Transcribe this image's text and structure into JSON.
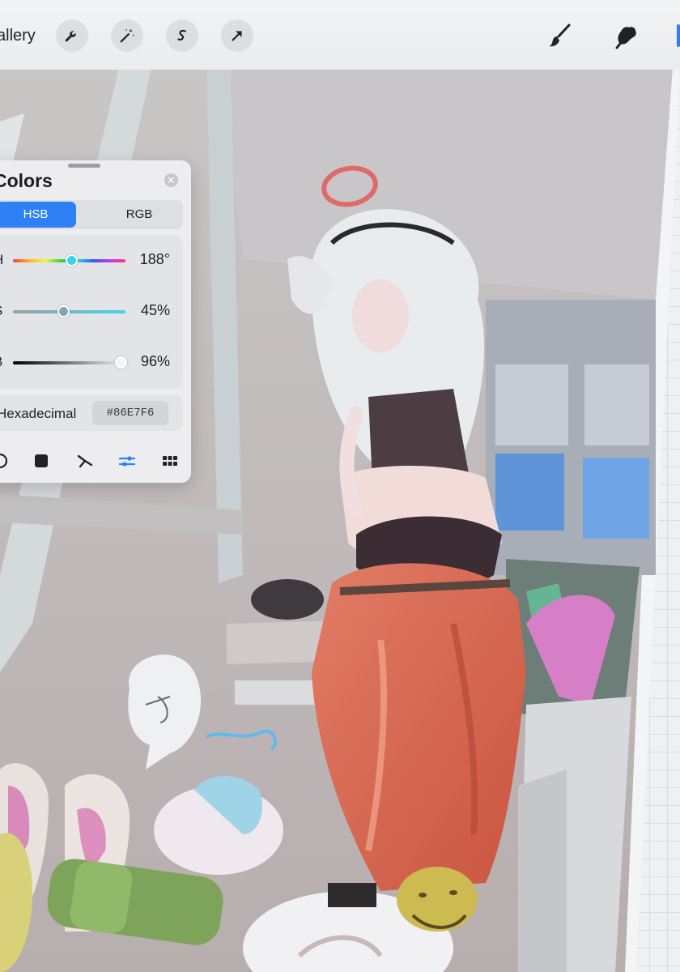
{
  "toolbar": {
    "gallery_label": "allery",
    "left_tools": [
      "wrench-icon",
      "magic-wand-icon",
      "selection-s-icon",
      "transform-arrow-icon"
    ],
    "right_tools": [
      "brush-icon",
      "smudge-icon"
    ]
  },
  "colors_panel": {
    "title": "Colors",
    "modes": [
      "HSB",
      "RGB"
    ],
    "active_mode": "HSB",
    "sliders": [
      {
        "letter": "H",
        "value_text": "188°",
        "fraction": 0.52
      },
      {
        "letter": "S",
        "value_text": "45%",
        "fraction": 0.45
      },
      {
        "letter": "B",
        "value_text": "96%",
        "fraction": 0.96
      }
    ],
    "hex_label": "Hexadecimal",
    "hex_value": "#86E7F6",
    "current_color": "#86E7F6",
    "tabs": [
      "disc-icon",
      "classic-icon",
      "harmony-icon",
      "value-icon",
      "palettes-icon"
    ],
    "active_tab": "value-icon"
  },
  "colors": {
    "accent": "#2F80F5",
    "toolbar_bg": "#F0F1F2",
    "panel_bg": "#EDEDEF"
  }
}
